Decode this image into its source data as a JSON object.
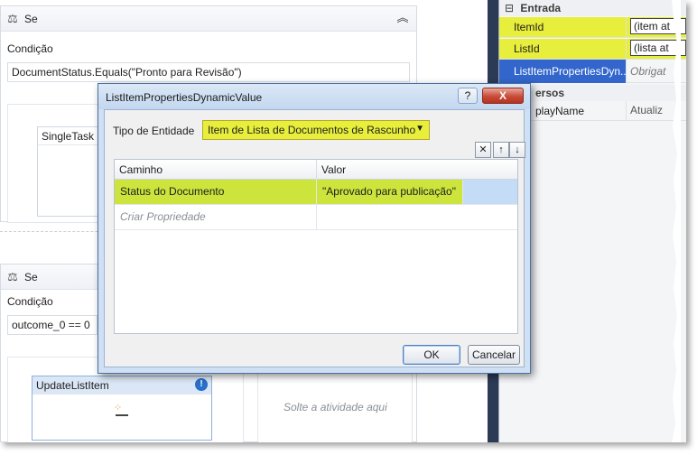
{
  "designer": {
    "if1": {
      "header": "Se",
      "condition_label": "Condição",
      "condition": "DocumentStatus.Equals(\"Pronto para Revisão\")",
      "subactivity": "SingleTask"
    },
    "if2": {
      "header": "Se",
      "condition_label": "Condição",
      "condition": "outcome_0 == 0",
      "subactivity": "UpdateListItem",
      "dropzone": "Solte a atividade aqui"
    }
  },
  "propgrid": {
    "category_input": "Entrada",
    "category_misc": "ersos",
    "rows": [
      {
        "name": "ItemId",
        "value": "(item at"
      },
      {
        "name": "ListId",
        "value": "(lista at"
      },
      {
        "name": "ListItemPropertiesDyn...",
        "value": "Obrigat"
      },
      {
        "name": "playName",
        "value": "Atualiz"
      }
    ]
  },
  "dialog": {
    "title": "ListItemPropertiesDynamicValue",
    "help": "?",
    "close": "X",
    "entity_label": "Tipo de Entidade",
    "entity_value": "Item de Lista de Documentos de Rascunho",
    "toolbar": {
      "delete": "✕",
      "up": "↑",
      "down": "↓"
    },
    "columns": [
      "Caminho",
      "Valor"
    ],
    "rows": [
      {
        "path": "Status do Documento",
        "value": "\"Aprovado para publicação\""
      }
    ],
    "new_row_placeholder": "Criar Propriedade",
    "ok": "OK",
    "cancel": "Cancelar"
  },
  "colors": {
    "highlight": "#e7ee3b",
    "row_selected": "#c5dcf7",
    "title_blue": "#cfe0f4"
  }
}
